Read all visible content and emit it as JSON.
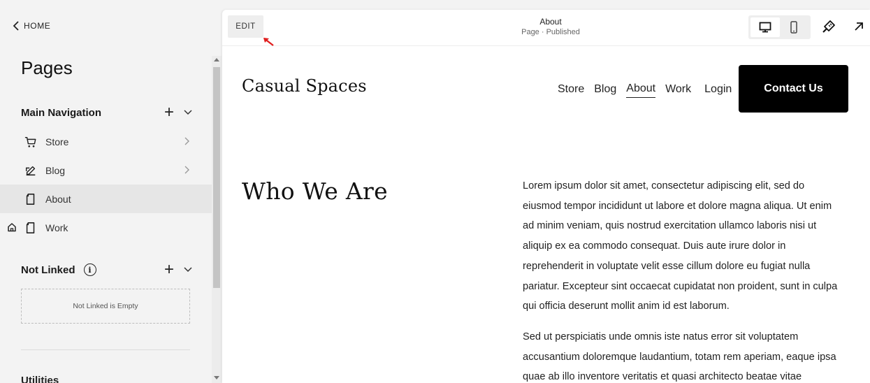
{
  "sidebar": {
    "home_label": "HOME",
    "title": "Pages",
    "main_nav": {
      "label": "Main Navigation",
      "items": [
        {
          "label": "Store",
          "icon": "cart-icon"
        },
        {
          "label": "Blog",
          "icon": "blog-edit-icon"
        },
        {
          "label": "About",
          "icon": "page-icon"
        },
        {
          "label": "Work",
          "icon": "page-icon"
        }
      ]
    },
    "not_linked": {
      "label": "Not Linked",
      "info_glyph": "i",
      "empty_text": "Not Linked is Empty"
    },
    "utilities_label": "Utilities"
  },
  "toolbar": {
    "edit_label": "EDIT",
    "page_title": "About",
    "page_status": "Page · Published"
  },
  "site": {
    "logo": "Casual Spaces",
    "nav": [
      "Store",
      "Blog",
      "About",
      "Work"
    ],
    "login": "Login",
    "cta": "Contact Us",
    "heading": "Who We Are",
    "paragraph1": "Lorem ipsum dolor sit amet, consectetur adipiscing elit, sed do eiusmod tempor incididunt ut labore et dolore magna aliqua. Ut enim ad minim veniam, quis nostrud exercitation ullamco laboris nisi ut aliquip ex ea commodo consequat. Duis aute irure dolor in reprehenderit in voluptate velit esse cillum dolore eu fugiat nulla pariatur. Excepteur sint occaecat cupidatat non proident, sunt in culpa qui officia deserunt mollit anim id est laborum.",
    "paragraph2": "Sed ut perspiciatis unde omnis iste natus error sit voluptatem accusantium doloremque laudantium, totam rem aperiam, eaque ipsa quae ab illo inventore veritatis et quasi architecto beatae vitae"
  },
  "colors": {
    "accent_arrow": "#e01e1e",
    "cta_bg": "#000000",
    "active_item_bg": "#e6e6e6"
  }
}
